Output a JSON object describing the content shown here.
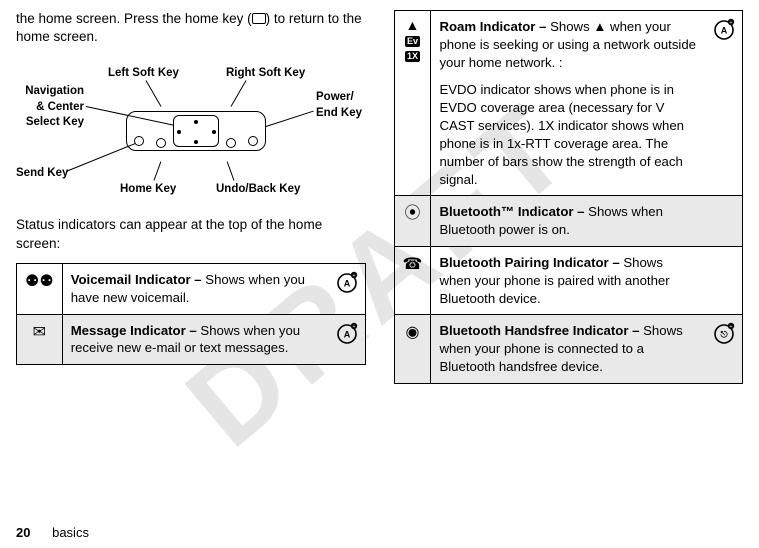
{
  "watermark": "DRAFT",
  "intro_prefix": "the home screen. Press the home key (",
  "intro_suffix": ") to return to the home screen.",
  "diagram": {
    "nav_center": "Navigation & Center Select Key",
    "left_soft": "Left Soft Key",
    "right_soft": "Right Soft Key",
    "power_end": "Power/ End Key",
    "send": "Send Key",
    "home": "Home Key",
    "undo": "Undo/Back Key"
  },
  "status_intro": "Status indicators can appear at the top of the home screen:",
  "left_rows": [
    {
      "icon": "voicemail-icon",
      "glyph": "⚉⚉",
      "name": "Voicemail Indicator – ",
      "text": "Shows when you have new voicemail.",
      "badge": "a",
      "shade": false
    },
    {
      "icon": "message-icon",
      "glyph": "✉",
      "name": "Message Indicator – ",
      "text": "Shows when you receive new e-mail or text messages.",
      "badge": "a",
      "shade": true
    }
  ],
  "right_rows": [
    {
      "icon": "roam-icon",
      "multi": {
        "tri": "▲",
        "ev": "Ev",
        "onex": "1X"
      },
      "name": "Roam Indicator – ",
      "text": "Shows ▲ when your phone is seeking or using a network outside your home network. :",
      "para2": "EVDO indicator shows when phone is in EVDO coverage area (necessary for V CAST services). 1X indicator shows when phone is in 1x-RTT coverage area. The number of bars show the strength of each signal.",
      "badge": "a",
      "shade": false
    },
    {
      "icon": "bluetooth-icon",
      "glyph": "⦿",
      "name": "Bluetooth™ Indicator – ",
      "text": "Shows when Bluetooth power is on.",
      "badge": null,
      "shade": true
    },
    {
      "icon": "bt-pair-icon",
      "glyph": "☎",
      "name": "Bluetooth Pairing Indicator – ",
      "text": "Shows when your phone is paired with another Bluetooth device.",
      "badge": null,
      "shade": false
    },
    {
      "icon": "bt-handsfree-icon",
      "glyph": "◉",
      "name": "Bluetooth Handsfree Indicator – ",
      "text": "Shows when your phone is connected to a Bluetooth handsfree device.",
      "badge": "d",
      "shade": true
    }
  ],
  "footer": {
    "page": "20",
    "section": "basics"
  }
}
